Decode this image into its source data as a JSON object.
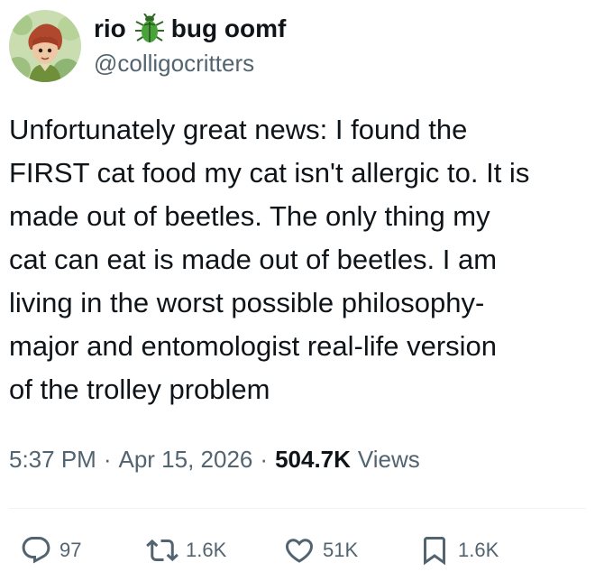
{
  "author": {
    "display_name_part1": "rio",
    "display_name_part2": "bug oomf",
    "name_emoji": "beetle-icon",
    "handle": "@colligocritters"
  },
  "tweet": {
    "text": "Unfortunately great news: I found the\nFIRST cat food my cat isn't allergic to. It is\nmade out of beetles. The only thing my\ncat can eat is made out of beetles. I am\nliving in the worst possible philosophy-\nmajor and entomologist real-life version\nof the trolley problem"
  },
  "meta": {
    "time": "5:37 PM",
    "separator": "·",
    "date": "Apr 15, 2026",
    "views_count": "504.7K",
    "views_label": "Views"
  },
  "actions": {
    "replies": "97",
    "retweets": "1.6K",
    "likes": "51K",
    "bookmarks": "1.6K"
  },
  "colors": {
    "text_primary": "#0f1419",
    "text_secondary": "#536471",
    "divider": "#eff3f4",
    "beetle_green": "#3f8f2f"
  }
}
